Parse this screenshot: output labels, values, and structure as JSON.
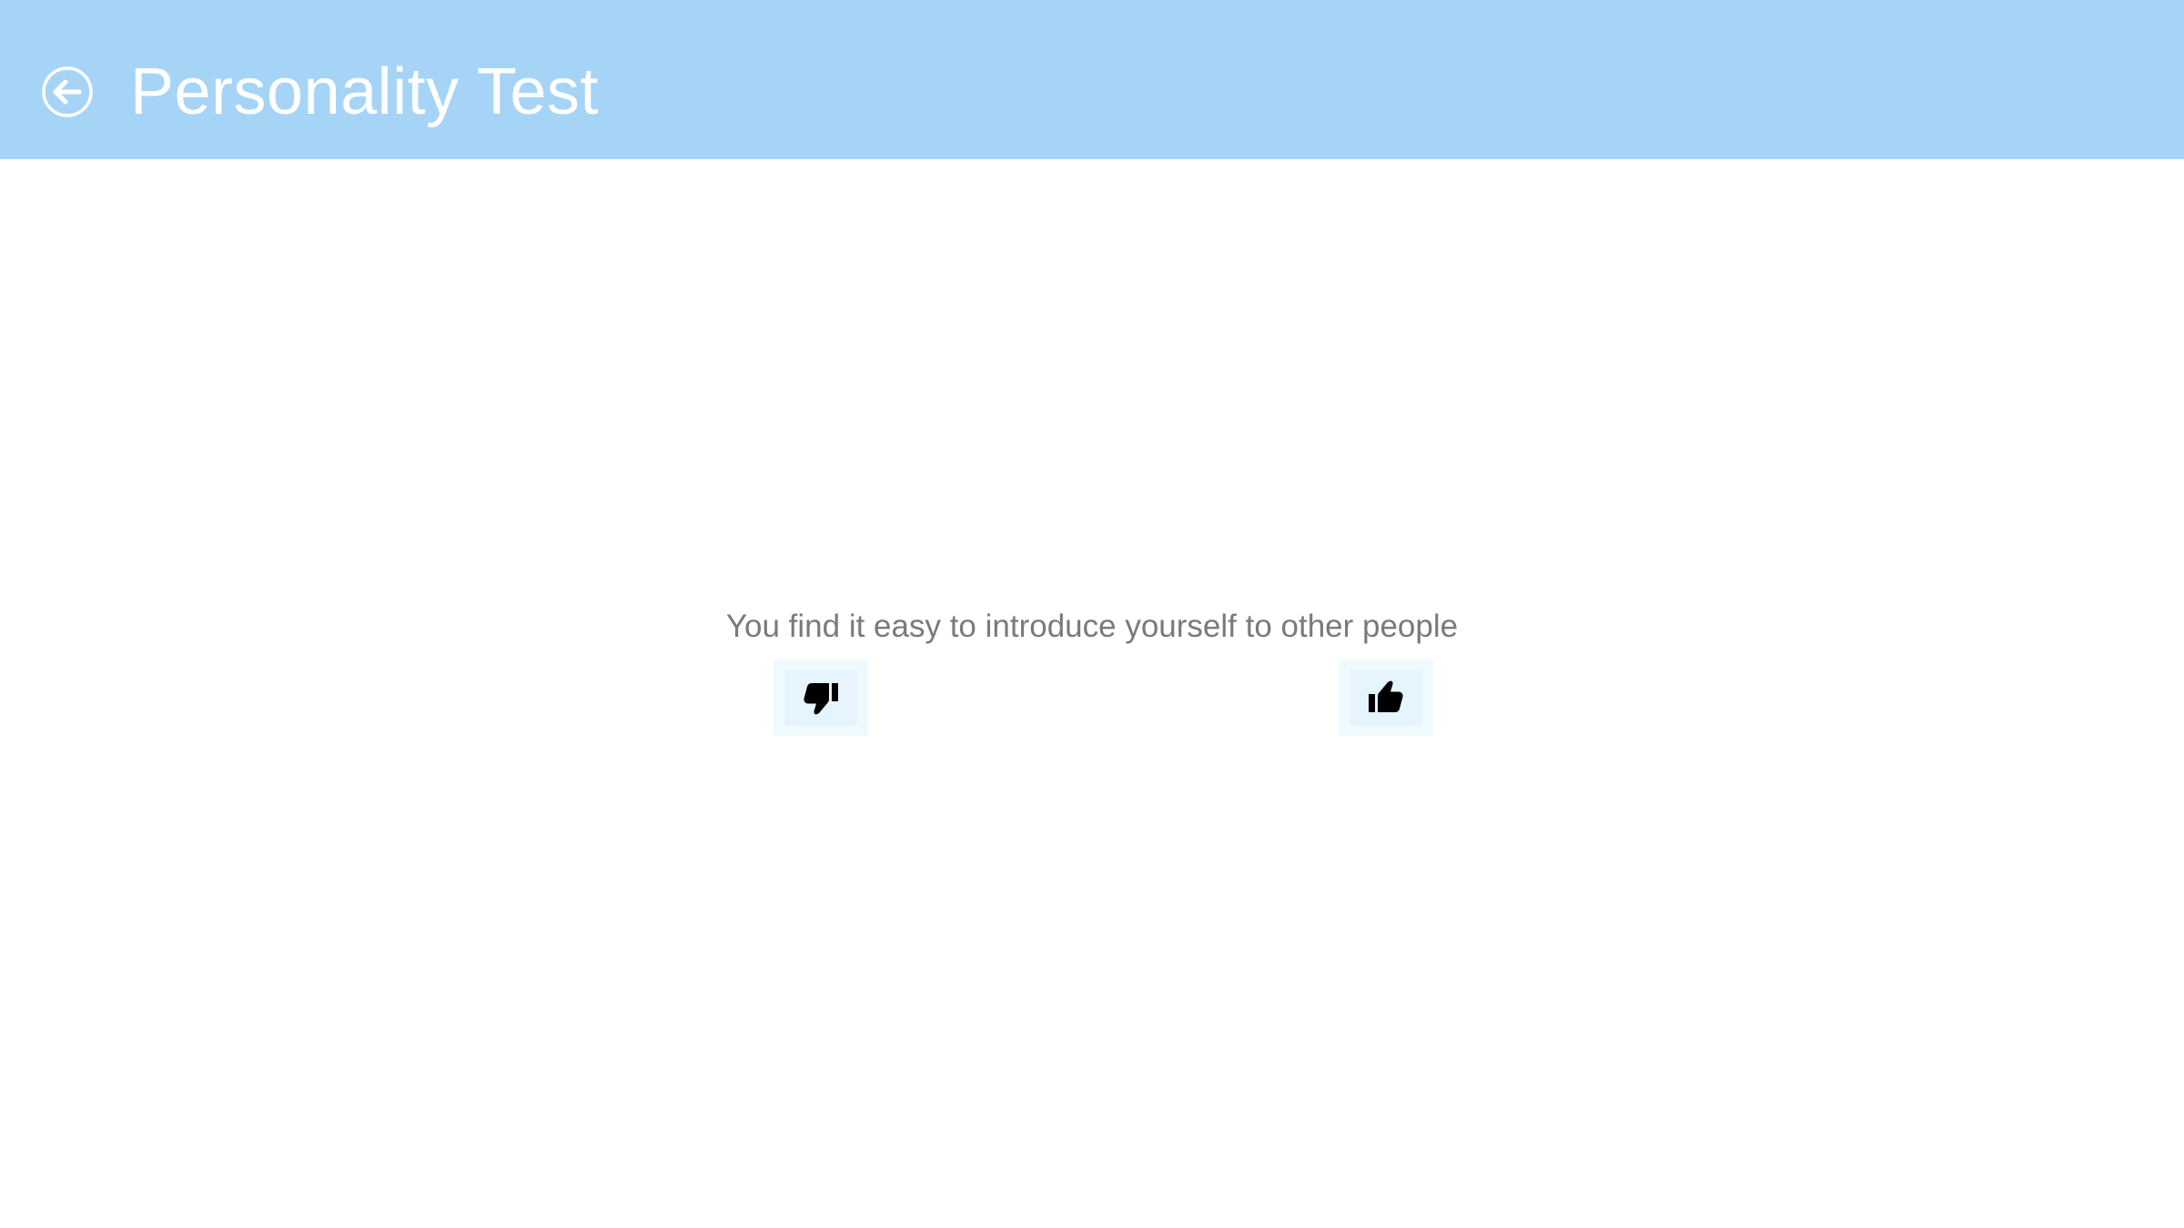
{
  "header": {
    "title": "Personality Test",
    "back_icon": "back-arrow-circle-icon",
    "background_color": "#a6d4f7",
    "text_color": "#ffffff"
  },
  "main": {
    "question": "You find it easy to introduce yourself to other people",
    "buttons": [
      {
        "icon": "thumbs-down-icon",
        "meaning": "disagree"
      },
      {
        "icon": "thumbs-up-icon",
        "meaning": "agree"
      }
    ],
    "question_color": "#7a7a7a",
    "button_background": "#effaff"
  }
}
